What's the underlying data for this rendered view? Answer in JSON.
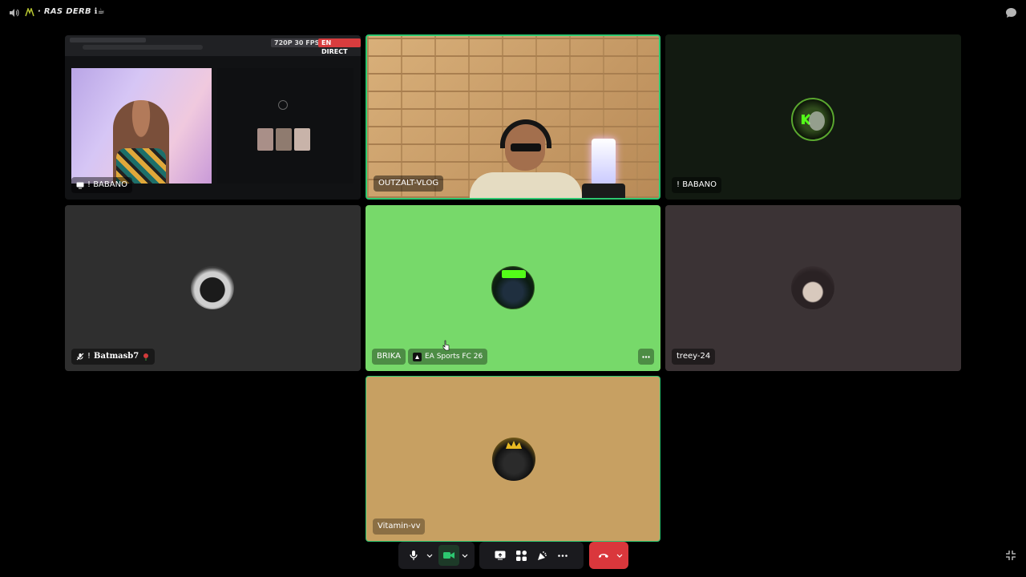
{
  "channel": {
    "name": "RAS DERB",
    "emoji": "ℹ☕"
  },
  "stream_badges": {
    "quality": "720P 30 FPS",
    "live": "EN DIRECT"
  },
  "tiles": {
    "babano_stream": {
      "name": "! BABANO"
    },
    "outzalt": {
      "name": "OUTZALT-VLOG"
    },
    "babano_cam": {
      "name": "! BABANO"
    },
    "batmasb": {
      "name": "Batmasb7"
    },
    "brika": {
      "name": "BRIKA",
      "activity": "EA Sports FC 26"
    },
    "treey": {
      "name": "treey-24"
    },
    "vitamin": {
      "name": "Vitamin-vv"
    }
  },
  "icons": [
    "speaker-icon",
    "channel-icon",
    "chat-icon",
    "mic-icon",
    "camera-icon",
    "screen-share-icon",
    "activities-icon",
    "soundboard-icon",
    "more-icon",
    "leave-call-icon",
    "fullscreen-icon"
  ],
  "colors": {
    "speaking": "#2dc770",
    "leave": "#da373c",
    "green_bg": "#77d96a",
    "tan_bg": "#c7a062",
    "dark_tile": "#2f2f2f",
    "treey_tile": "#3b3335"
  }
}
